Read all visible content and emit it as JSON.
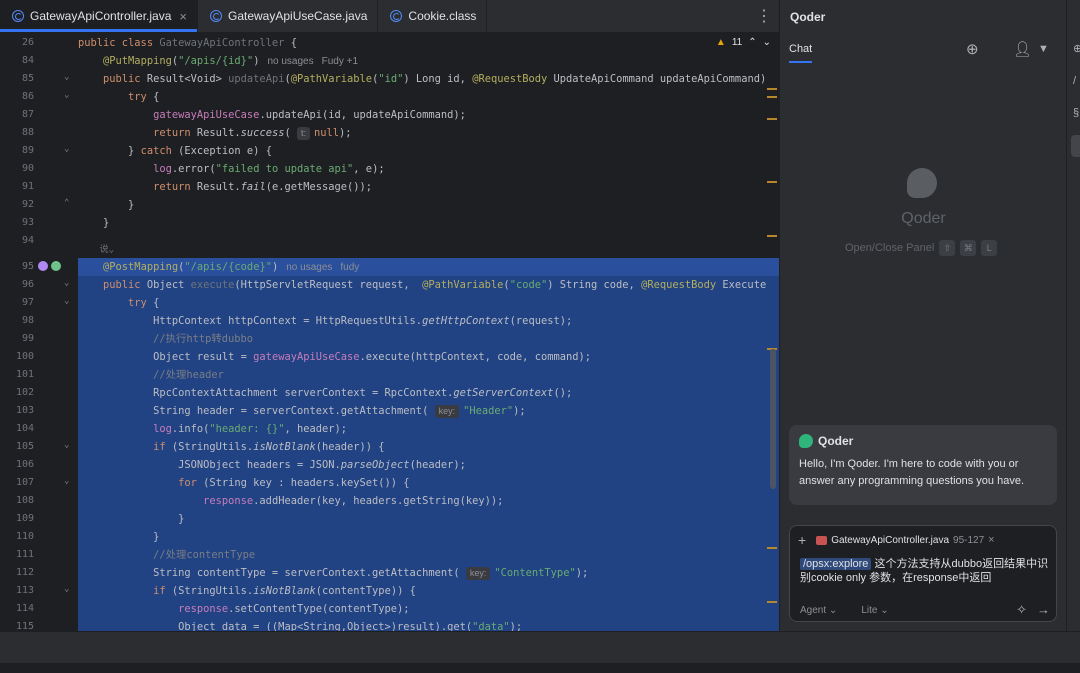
{
  "tabs": [
    {
      "label": "GatewayApiController.java",
      "active": true,
      "closable": true
    },
    {
      "label": "GatewayApiUseCase.java",
      "active": false,
      "closable": false
    },
    {
      "label": "Cookie.class",
      "active": false,
      "closable": false
    }
  ],
  "editor": {
    "warning_count": "11",
    "hints": {
      "no_usages": "no usages",
      "fudy_plus": "Fudy +1",
      "fudy": "fudy"
    },
    "line_numbers": [
      "26",
      "84",
      "85",
      "86",
      "87",
      "88",
      "89",
      "90",
      "91",
      "92",
      "93",
      "94",
      "",
      "95",
      "96",
      "97",
      "98",
      "99",
      "100",
      "101",
      "102",
      "103",
      "104",
      "105",
      "106",
      "107",
      "108",
      "109",
      "110",
      "111",
      "112",
      "113",
      "114",
      "115"
    ]
  },
  "panel": {
    "title": "Qoder",
    "chat_tab": "Chat",
    "empty_title": "Qoder",
    "empty_sub": "Open/Close Panel",
    "kbd1": "⇧",
    "kbd2": "⌘",
    "kbd3": "L",
    "message": {
      "sender": "Qoder",
      "text": "Hello, I'm Qoder. I'm here to code with you or answer any programming questions you have."
    },
    "input": {
      "context_file": "GatewayApiController.java",
      "context_range": "95-127",
      "command": "/opsx:explore",
      "prompt_text": " 这个方法支持从dubbo返回结果中识别cookie only 参数，在response中返回",
      "mode": "Agent",
      "model": "Lite"
    }
  },
  "colors": {
    "accent": "#3574f0",
    "selection": "#214283",
    "qoder_green": "#2fb47b"
  }
}
